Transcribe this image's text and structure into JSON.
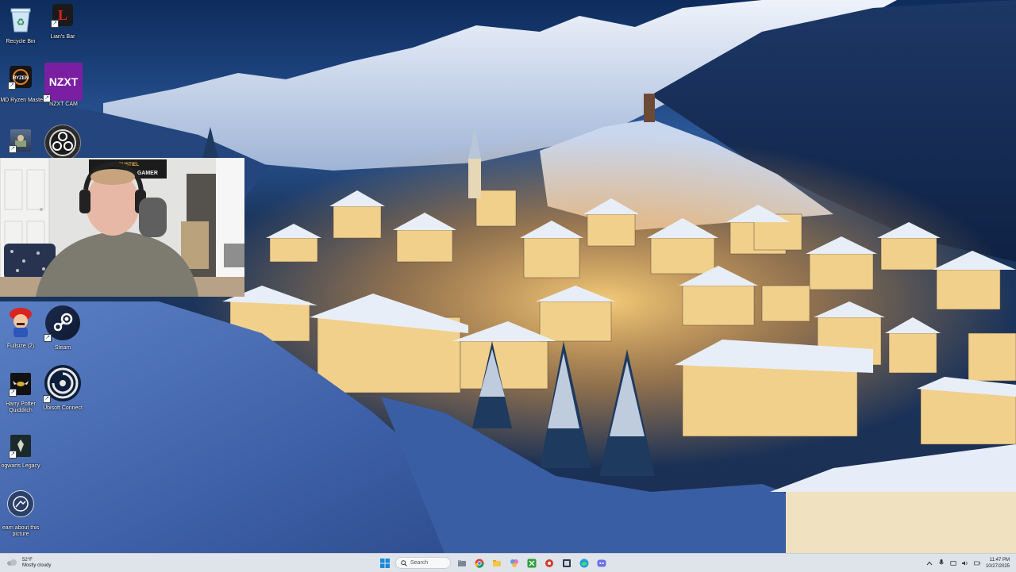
{
  "desktop": {
    "icons": [
      {
        "label": "Recycle Bin",
        "icon": "recycle-bin-icon"
      },
      {
        "label": "Lian's Bar",
        "icon": "red-l-icon"
      },
      {
        "label": "AMD Ryzen Master",
        "icon": "ryzen-master-icon"
      },
      {
        "label": "NZXT CAM",
        "icon": "nzxt-cam-icon",
        "glyph": "NZXT"
      },
      {
        "label": "",
        "icon": "game-thumbnail-icon"
      },
      {
        "label": "",
        "icon": "obs-studio-icon"
      },
      {
        "label": "Fullsize (2)",
        "icon": "mario-icon"
      },
      {
        "label": "Steam",
        "icon": "steam-icon"
      },
      {
        "label": "Harry Potter Quidditch",
        "icon": "harry-potter-quidditch-icon"
      },
      {
        "label": "Ubisoft Connect",
        "icon": "ubisoft-connect-icon"
      },
      {
        "label": "ogwarts Legacy",
        "icon": "hogwarts-legacy-icon"
      },
      {
        "label": "earn about this picture",
        "icon": "learn-about-picture-icon"
      }
    ]
  },
  "webcam": {
    "sign_text": "THE EXTREME GAMER",
    "sign_top": "GRUSTIEL"
  },
  "taskbar": {
    "weather": {
      "temp": "52°F",
      "condition": "Mostly cloudy",
      "icon": "weather-cloud-icon"
    },
    "search_placeholder": "Search",
    "apps": [
      {
        "icon": "start-windows-icon"
      },
      {
        "icon": "file-explorer-icon"
      },
      {
        "icon": "chrome-icon"
      },
      {
        "icon": "folder-icon"
      },
      {
        "icon": "photos-icon"
      },
      {
        "icon": "xbox-icon"
      },
      {
        "icon": "app-red-icon"
      },
      {
        "icon": "media-icon"
      },
      {
        "icon": "edge-icon"
      },
      {
        "icon": "discord-icon"
      }
    ],
    "tray": {
      "icons": [
        "chevron-up-icon",
        "microphone-icon",
        "wifi-icon",
        "volume-icon",
        "battery-icon"
      ],
      "time": "11:47 PM",
      "date": "10/27/2025"
    }
  }
}
